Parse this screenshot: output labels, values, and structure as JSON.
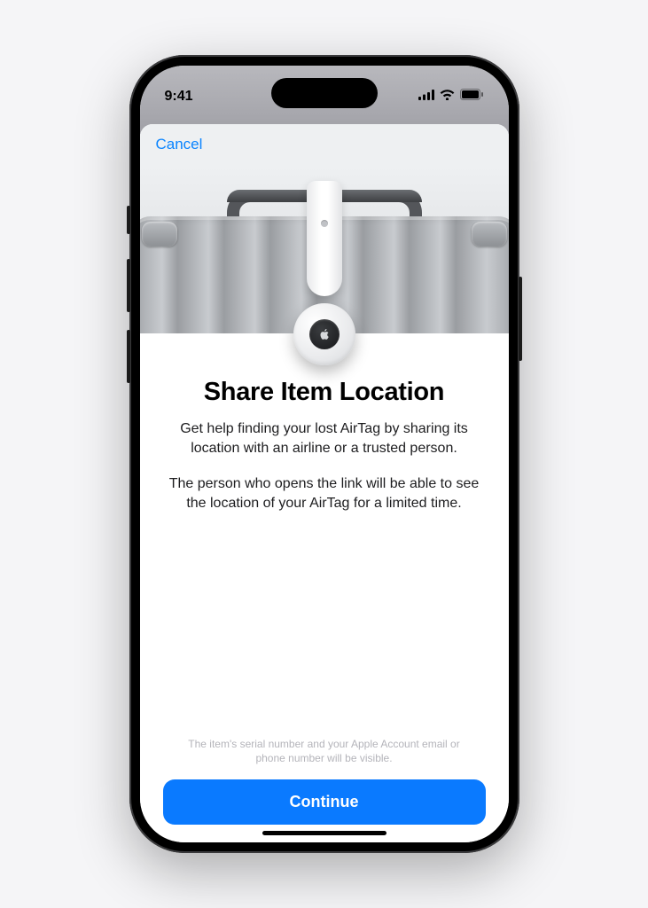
{
  "status_bar": {
    "time": "9:41",
    "signal_icon": "cellular-signal-icon",
    "wifi_icon": "wifi-icon",
    "battery_icon": "battery-icon"
  },
  "sheet": {
    "cancel_label": "Cancel",
    "title": "Share Item Location",
    "description_1": "Get help finding your lost AirTag by sharing its location with an airline or a trusted person.",
    "description_2": "The person who opens the link will be able to see the location of your AirTag for a limited time.",
    "footnote": "The item's serial number and your Apple Account email or phone number will be visible.",
    "continue_label": "Continue"
  },
  "illustration": {
    "item": "luggage-with-airtag",
    "airtag_icon": "airtag-icon",
    "apple_logo": "apple-logo-icon"
  },
  "colors": {
    "accent": "#0a7aff",
    "link": "#0a84ff"
  }
}
